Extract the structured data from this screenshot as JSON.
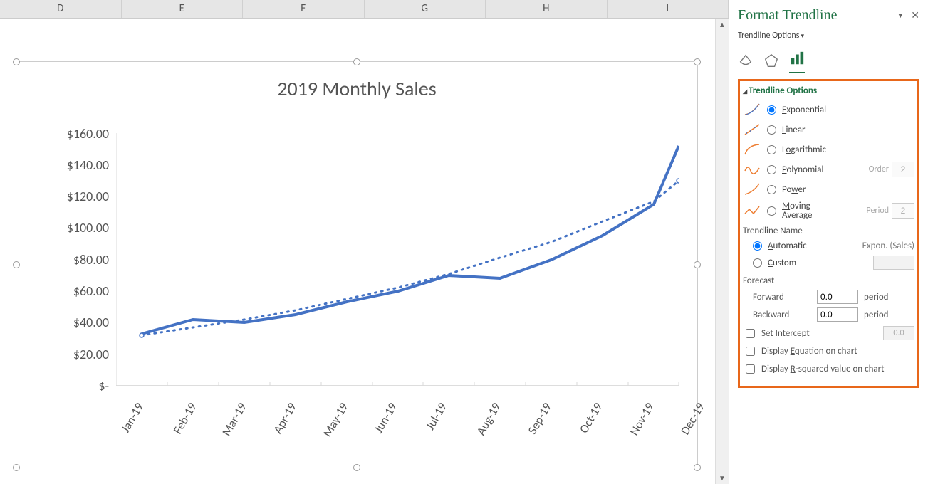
{
  "columns": [
    "D",
    "E",
    "F",
    "G",
    "H",
    "I"
  ],
  "pane": {
    "title": "Format Trendline",
    "subtitle": "Trendline Options",
    "section": "Trendline Options",
    "types": {
      "exponential": "Exponential",
      "linear": "Linear",
      "logarithmic": "Logarithmic",
      "polynomial": "Polynomial",
      "power": "Power",
      "moving": "Moving Average",
      "order_label": "Order",
      "order_value": "2",
      "period_label": "Period",
      "period_value": "2",
      "selected": "exponential"
    },
    "name": {
      "header": "Trendline Name",
      "automatic": "Automatic",
      "custom": "Custom",
      "auto_value": "Expon. (Sales)"
    },
    "forecast": {
      "header": "Forecast",
      "forward_label": "Forward",
      "forward_value": "0.0",
      "backward_label": "Backward",
      "backward_value": "0.0",
      "unit": "period"
    },
    "intercept": {
      "label": "Set Intercept",
      "value": "0.0"
    },
    "disp_eq": "Display Equation on chart",
    "disp_r2": "Display R-squared value on chart"
  },
  "chart_data": {
    "type": "line",
    "title": "2019 Monthly Sales",
    "xlabel": "",
    "ylabel": "",
    "categories": [
      "Jan-19",
      "Feb-19",
      "Mar-19",
      "Apr-19",
      "May-19",
      "Jun-19",
      "Jul-19",
      "Aug-19",
      "Sep-19",
      "Oct-19",
      "Nov-19",
      "Dec-19"
    ],
    "y_ticks": [
      "$160.00",
      "$140.00",
      "$120.00",
      "$100.00",
      "$80.00",
      "$60.00",
      "$40.00",
      "$20.00",
      "$-"
    ],
    "ylim": [
      0,
      160
    ],
    "series": [
      {
        "name": "Sales",
        "type": "line",
        "values": [
          33,
          42,
          40,
          45,
          53,
          60,
          70,
          68,
          80,
          95,
          115,
          152
        ]
      },
      {
        "name": "Expon. (Sales)",
        "type": "trendline",
        "style": "dotted",
        "values": [
          32,
          37,
          42,
          48,
          55,
          62,
          71,
          81,
          91,
          104,
          117,
          130
        ]
      }
    ]
  }
}
